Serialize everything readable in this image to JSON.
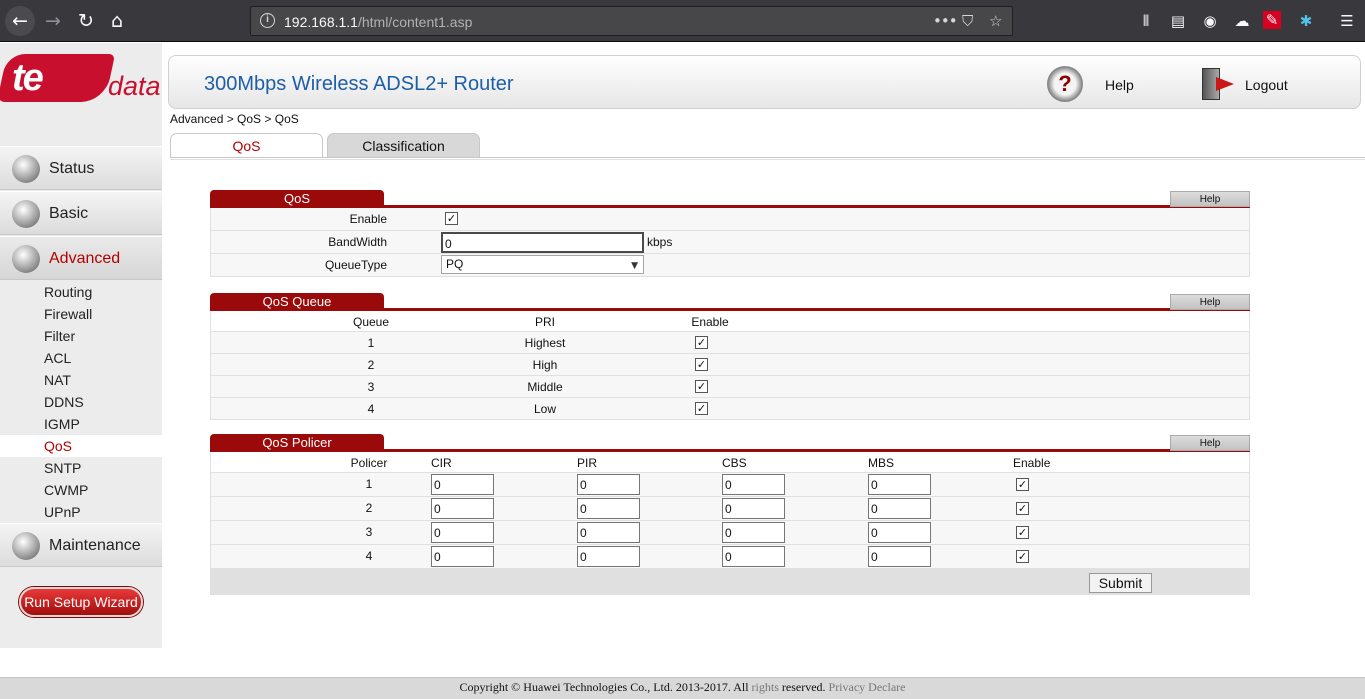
{
  "browser": {
    "url_host": "192.168.1.1",
    "url_path": "/html/content1.asp",
    "back_icon": "←",
    "forward_icon": "→",
    "reload_icon": "↻",
    "home_icon": "⌂",
    "info_icon": "i",
    "more_icon": "•••",
    "pocket_icon": "⛉",
    "star_icon": "☆",
    "library_icon": "⫴",
    "reader_icon": "▤",
    "ext1_icon": "◉",
    "ext2_icon": "☁",
    "ext3_icon": "✎",
    "ext4_icon": "✱",
    "menu_icon": "☰"
  },
  "logo": {
    "brand_te": "te",
    "brand_data": "data"
  },
  "sidebar": {
    "main": [
      {
        "label": "Status"
      },
      {
        "label": "Basic"
      },
      {
        "label": "Advanced"
      },
      {
        "label": "Maintenance"
      }
    ],
    "sub": [
      "Routing",
      "Firewall",
      "Filter",
      "ACL",
      "NAT",
      "DDNS",
      "IGMP",
      "QoS",
      "SNTP",
      "CWMP",
      "UPnP"
    ],
    "wizard_label": "Run Setup Wizard"
  },
  "header": {
    "title": "300Mbps Wireless ADSL2+ Router",
    "help_label": "Help",
    "help_icon": "?",
    "logout_label": "Logout"
  },
  "breadcrumb": "Advanced > QoS > QoS",
  "tabs": {
    "qos": "QoS",
    "classification": "Classification"
  },
  "qos": {
    "title": "QoS",
    "help": "Help",
    "enable_label": "Enable",
    "bandwidth_label": "BandWidth",
    "bandwidth_value": "0",
    "bandwidth_unit": "kbps",
    "queuetype_label": "QueueType",
    "queuetype_value": "PQ",
    "check": "✓"
  },
  "queue": {
    "title": "QoS Queue",
    "help": "Help",
    "headers": {
      "queue": "Queue",
      "pri": "PRI",
      "enable": "Enable"
    },
    "rows": [
      {
        "queue": "1",
        "pri": "Highest"
      },
      {
        "queue": "2",
        "pri": "High"
      },
      {
        "queue": "3",
        "pri": "Middle"
      },
      {
        "queue": "4",
        "pri": "Low"
      }
    ]
  },
  "policer": {
    "title": "QoS Policer",
    "help": "Help",
    "headers": {
      "policer": "Policer",
      "cir": "CIR",
      "pir": "PIR",
      "cbs": "CBS",
      "mbs": "MBS",
      "enable": "Enable"
    },
    "rows": [
      {
        "policer": "1",
        "cir": "0",
        "pir": "0",
        "cbs": "0",
        "mbs": "0"
      },
      {
        "policer": "2",
        "cir": "0",
        "pir": "0",
        "cbs": "0",
        "mbs": "0"
      },
      {
        "policer": "3",
        "cir": "0",
        "pir": "0",
        "cbs": "0",
        "mbs": "0"
      },
      {
        "policer": "4",
        "cir": "0",
        "pir": "0",
        "cbs": "0",
        "mbs": "0"
      }
    ],
    "submit_label": "Submit"
  },
  "footer": {
    "copyright": "Copyright © Huawei Technologies Co., Ltd. 2013-2017. All",
    "rights": "rights",
    "reserved": "reserved.",
    "privacy": "Privacy Declare"
  }
}
